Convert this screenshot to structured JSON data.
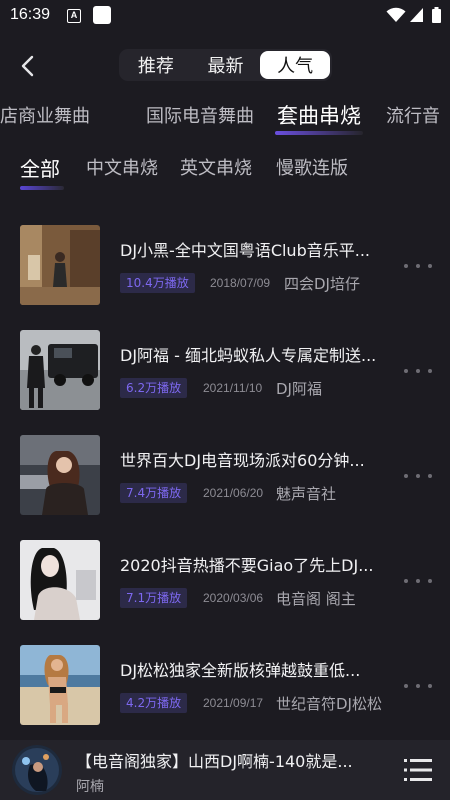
{
  "status_bar": {
    "time": "16:39",
    "notif_a": "A",
    "icons": [
      "a-notification-icon",
      "app-notification-icon",
      "wifi-icon",
      "signal-icon",
      "battery-icon"
    ]
  },
  "header": {
    "segments": [
      "推荐",
      "最新",
      "人气"
    ],
    "active_segment": "人气"
  },
  "categories": [
    "夜店商业舞曲",
    "国际电音舞曲",
    "套曲串烧",
    "流行音"
  ],
  "active_category": "套曲串烧",
  "sub_tabs": [
    "全部",
    "中文串烧",
    "英文串烧",
    "慢歌连版"
  ],
  "active_sub_tab": "全部",
  "tracks": [
    {
      "title": "DJ小黑-全中文国粤语Club音乐平...",
      "plays": "10.4万播放",
      "date": "2018/07/09",
      "author": "四会DJ培仔"
    },
    {
      "title": "DJ阿福 - 缅北蚂蚁私人专属定制送...",
      "plays": "6.2万播放",
      "date": "2021/11/10",
      "author": "DJ阿福"
    },
    {
      "title": "世界百大DJ电音现场派对60分钟...",
      "plays": "7.4万播放",
      "date": "2021/06/20",
      "author": "魅声音社"
    },
    {
      "title": "2020抖音热播不要Giao了先上DJ...",
      "plays": "7.1万播放",
      "date": "2020/03/06",
      "author": "电音阁 阁主"
    },
    {
      "title": "DJ松松独家全新版核弹越鼓重低...",
      "plays": "4.2万播放",
      "date": "2021/09/17",
      "author": "世纪音符DJ松松"
    }
  ],
  "player": {
    "title": "【电音阁独家】山西DJ啊楠-140就是...",
    "artist": "阿楠"
  },
  "colors": {
    "background": "#1c1b21",
    "accent": "#6b4fe0",
    "badge_bg": "#2c2a48",
    "badge_text": "#7d68ef"
  }
}
